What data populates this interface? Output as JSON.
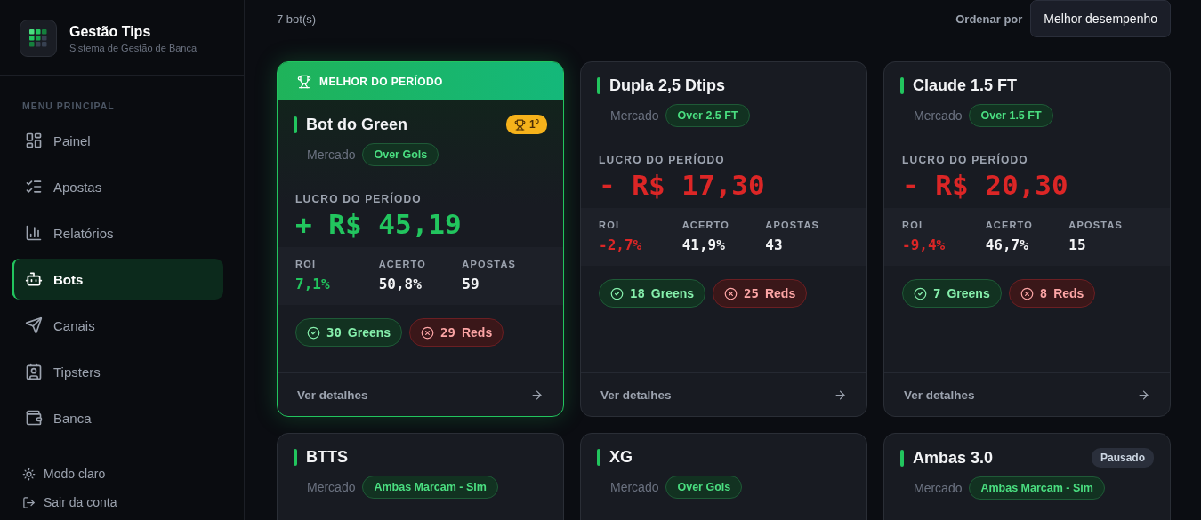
{
  "brand": {
    "title": "Gestão Tips",
    "subtitle": "Sistema de Gestão de Banca"
  },
  "sidebar": {
    "section_title": "MENU PRINCIPAL",
    "items": [
      {
        "label": "Painel",
        "selected": false
      },
      {
        "label": "Apostas",
        "selected": false
      },
      {
        "label": "Relatórios",
        "selected": false
      },
      {
        "label": "Bots",
        "selected": true
      },
      {
        "label": "Canais",
        "selected": false
      },
      {
        "label": "Tipsters",
        "selected": false
      },
      {
        "label": "Banca",
        "selected": false
      }
    ],
    "footer": [
      {
        "label": "Modo claro"
      },
      {
        "label": "Sair da conta"
      }
    ]
  },
  "toolbar": {
    "count": "7 bot(s)",
    "sort_label": "Ordenar por",
    "sort_value": "Melhor desempenho"
  },
  "bots": [
    {
      "name": "Bot do Green",
      "highlighted": true,
      "banner": "MELHOR DO PERÍODO",
      "rank": "1º",
      "market_label": "Mercado",
      "market": "Over Gols",
      "profit": {
        "label": "LUCRO DO PERÍODO",
        "value": "+ R$ 45,19",
        "color": "#22c55e"
      },
      "stats": [
        {
          "label": "ROI",
          "value": "7,1%",
          "color": "#22c55e"
        },
        {
          "label": "ACERTO",
          "value": "50,8%",
          "color": "#f3f4f6"
        },
        {
          "label": "APOSTAS",
          "value": "59",
          "color": "#f3f4f6"
        }
      ],
      "results": [
        {
          "kind": "green",
          "count": "30",
          "label": "Greens"
        },
        {
          "kind": "red",
          "count": "29",
          "label": "Reds"
        }
      ],
      "link": "Ver detalhes"
    },
    {
      "name": "Dupla 2,5 Dtips",
      "highlighted": false,
      "market_label": "Mercado",
      "market": "Over 2.5 FT",
      "profit": {
        "label": "LUCRO DO PERÍODO",
        "value": "- R$ 17,30",
        "color": "#dc2626"
      },
      "stats": [
        {
          "label": "ROI",
          "value": "-2,7%",
          "color": "#dc2626"
        },
        {
          "label": "ACERTO",
          "value": "41,9%",
          "color": "#f3f4f6"
        },
        {
          "label": "APOSTAS",
          "value": "43",
          "color": "#f3f4f6"
        }
      ],
      "results": [
        {
          "kind": "green",
          "count": "18",
          "label": "Greens"
        },
        {
          "kind": "red",
          "count": "25",
          "label": "Reds"
        }
      ],
      "link": "Ver detalhes"
    },
    {
      "name": "Claude 1.5 FT",
      "highlighted": false,
      "market_label": "Mercado",
      "market": "Over 1.5 FT",
      "profit": {
        "label": "LUCRO DO PERÍODO",
        "value": "- R$ 20,30",
        "color": "#dc2626"
      },
      "stats": [
        {
          "label": "ROI",
          "value": "-9,4%",
          "color": "#dc2626"
        },
        {
          "label": "ACERTO",
          "value": "46,7%",
          "color": "#f3f4f6"
        },
        {
          "label": "APOSTAS",
          "value": "15",
          "color": "#f3f4f6"
        }
      ],
      "results": [
        {
          "kind": "green",
          "count": "7",
          "label": "Greens"
        },
        {
          "kind": "red",
          "count": "8",
          "label": "Reds"
        }
      ],
      "link": "Ver detalhes"
    },
    {
      "name": "BTTS",
      "highlighted": false,
      "market_label": "Mercado",
      "market": "Ambas Marcam - Sim"
    },
    {
      "name": "XG",
      "highlighted": false,
      "market_label": "Mercado",
      "market": "Over Gols"
    },
    {
      "name": "Ambas 3.0",
      "highlighted": false,
      "status": "Pausado",
      "market_label": "Mercado",
      "market": "Ambas Marcam - Sim"
    }
  ]
}
